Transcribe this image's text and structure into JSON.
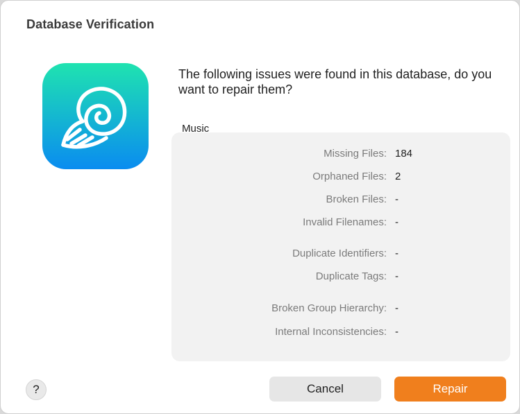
{
  "dialog": {
    "title": "Database Verification",
    "icon": "nautilus-shell-app-icon",
    "message": "The following issues were found in this database, do you want to repair them?",
    "database_name": "Music"
  },
  "issues": [
    {
      "label": "Missing Files:",
      "value": "184"
    },
    {
      "label": "Orphaned Files:",
      "value": "2"
    },
    {
      "label": "Broken Files:",
      "value": "-"
    },
    {
      "label": "Invalid Filenames:",
      "value": "-"
    },
    {
      "label": "Duplicate Identifiers:",
      "value": "-"
    },
    {
      "label": "Duplicate Tags:",
      "value": "-"
    },
    {
      "label": "Broken Group Hierarchy:",
      "value": "-"
    },
    {
      "label": "Internal Inconsistencies:",
      "value": "-"
    }
  ],
  "buttons": {
    "help": "?",
    "cancel": "Cancel",
    "repair": "Repair"
  },
  "colors": {
    "accent": "#f07f1d",
    "icon_gradient_top": "#1fe3b0",
    "icon_gradient_bottom": "#0a8cf0"
  }
}
